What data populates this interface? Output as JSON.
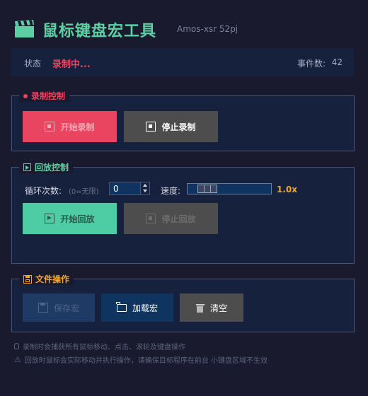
{
  "header": {
    "title": "鼠标键盘宏工具",
    "author": "Amos-xsr 52pj",
    "icon": "clapperboard-icon",
    "accent": "#5ecfa2"
  },
  "status": {
    "label": "状态",
    "value": "录制中...",
    "event_label": "事件数:",
    "event_count": "42",
    "value_color": "#e94560"
  },
  "record": {
    "title": "录制控制",
    "title_color": "#e94560",
    "start_label": "开始录制",
    "stop_label": "停止录制"
  },
  "playback": {
    "title": "回放控制",
    "title_color": "#5ecfa2",
    "loop_label": "循环次数:",
    "loop_hint": "(0=无限)",
    "loop_value": "0",
    "speed_label": "速度:",
    "speed_value": "1.0x",
    "speed_fraction": 0.16,
    "start_label": "开始回放",
    "stop_label": "停止回放"
  },
  "file": {
    "title": "文件操作",
    "title_color": "#f5a623",
    "save_label": "保存宏",
    "load_label": "加载宏",
    "clear_label": "清空"
  },
  "tips": {
    "tip1": "录制时会捕获所有鼠标移动、点击、滚轮及键盘操作",
    "tip2": "回放时鼠标会实际移动并执行操作，请确保目标程序在前台  小键盘区域不生效"
  }
}
